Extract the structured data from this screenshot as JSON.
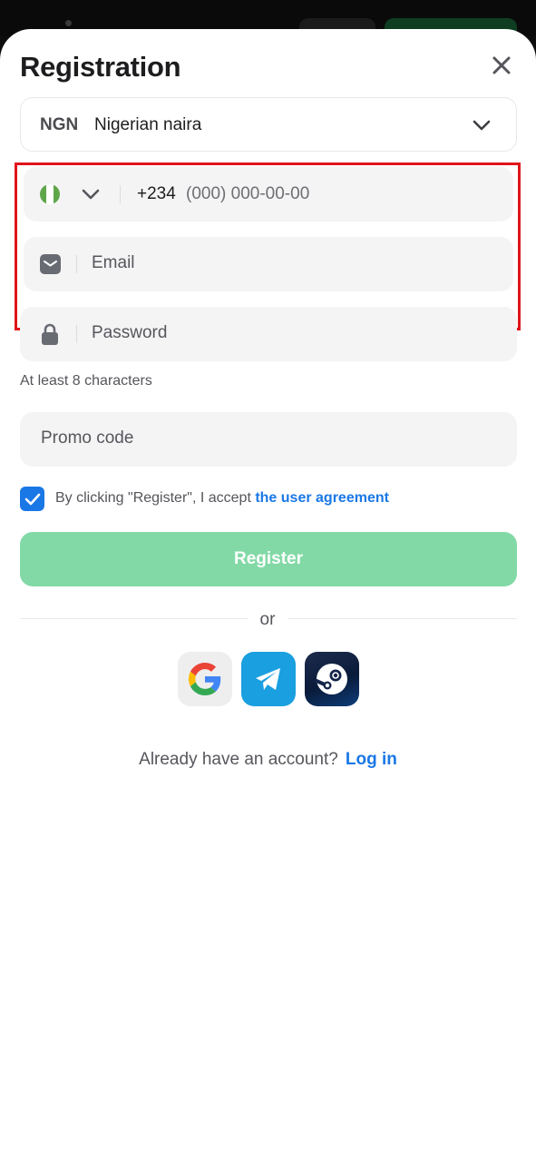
{
  "title": "Registration",
  "currency": {
    "code": "NGN",
    "name": "Nigerian naira"
  },
  "phone": {
    "prefix": "+234",
    "mask": "(000) 000-00-00"
  },
  "email": {
    "placeholder": "Email"
  },
  "password": {
    "placeholder": "Password",
    "hint": "At least 8 characters"
  },
  "promo": {
    "placeholder": "Promo code"
  },
  "agreement": {
    "checked": true,
    "text": "By clicking \"Register\", I accept ",
    "link": "the user agreement"
  },
  "register_label": "Register",
  "or_label": "or",
  "social": [
    "google-icon",
    "telegram-icon",
    "steam-icon"
  ],
  "footer": {
    "text": "Already have an account?",
    "link": "Log in"
  },
  "colors": {
    "accent": "#1a78e6",
    "register_button": "#82d9a6",
    "highlight": "#e0141b"
  }
}
